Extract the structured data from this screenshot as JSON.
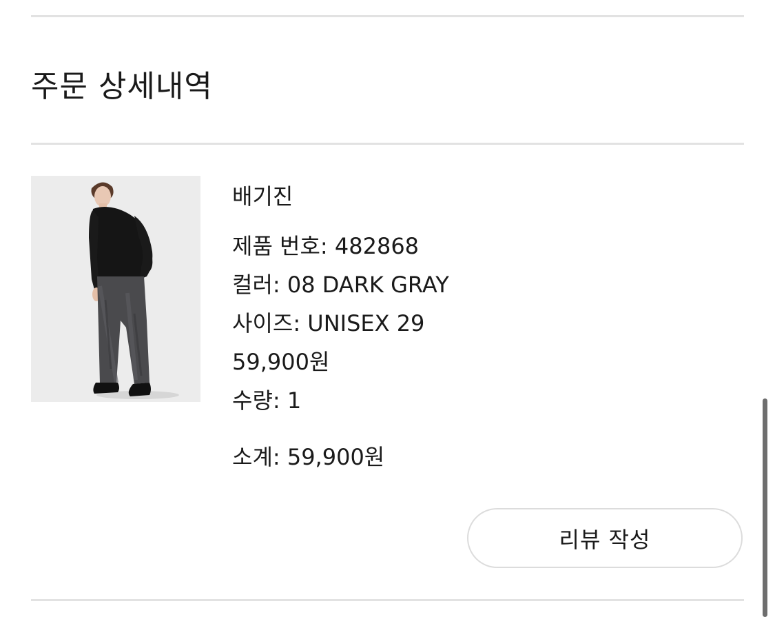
{
  "header": {
    "title": "주문 상세내역"
  },
  "order_item": {
    "image_name": "product-photo",
    "name": "배기진",
    "product_code": "제품 번호: 482868",
    "color": "컬러: 08 DARK GRAY",
    "size": "사이즈: UNISEX 29",
    "price": "59,900원",
    "quantity": "수량: 1",
    "subtotal": "소계: 59,900원"
  },
  "actions": {
    "review_label": "리뷰 작성"
  },
  "colors": {
    "divider": "#e2e2e2",
    "text": "#1a1a1a",
    "button_border": "#dcdcdc",
    "image_bg": "#ececec"
  }
}
